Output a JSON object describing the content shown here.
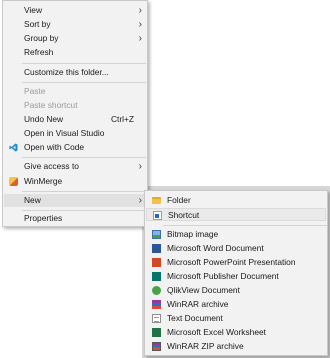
{
  "context_menu": {
    "items": [
      {
        "label": "View",
        "submenu": true
      },
      {
        "label": "Sort by",
        "submenu": true
      },
      {
        "label": "Group by",
        "submenu": true
      },
      {
        "label": "Refresh"
      },
      {
        "label": "Customize this folder..."
      },
      {
        "label": "Paste",
        "disabled": true
      },
      {
        "label": "Paste shortcut",
        "disabled": true
      },
      {
        "label": "Undo New",
        "shortcut": "Ctrl+Z"
      },
      {
        "label": "Open in Visual Studio"
      },
      {
        "label": "Open with Code",
        "icon": "vscode-icon"
      },
      {
        "label": "Give access to",
        "submenu": true
      },
      {
        "label": "WinMerge",
        "icon": "winmerge-icon"
      },
      {
        "label": "New",
        "submenu": true,
        "highlighted": true
      },
      {
        "label": "Properties"
      }
    ],
    "chevron_glyph": "›"
  },
  "new_submenu": {
    "items": [
      {
        "label": "Folder",
        "icon": "folder-icon"
      },
      {
        "label": "Shortcut",
        "icon": "shortcut-icon",
        "highlighted": true
      },
      {
        "label": "Bitmap image",
        "icon": "bitmap-icon"
      },
      {
        "label": "Microsoft Word Document",
        "icon": "word-icon"
      },
      {
        "label": "Microsoft PowerPoint Presentation",
        "icon": "ppt-icon"
      },
      {
        "label": "Microsoft Publisher Document",
        "icon": "publisher-icon"
      },
      {
        "label": "QlikView Document",
        "icon": "qlik-icon"
      },
      {
        "label": "WinRAR archive",
        "icon": "rar-icon"
      },
      {
        "label": "Text Document",
        "icon": "text-icon"
      },
      {
        "label": "Microsoft Excel Worksheet",
        "icon": "excel-icon"
      },
      {
        "label": "WinRAR ZIP archive",
        "icon": "rarzip-icon"
      }
    ]
  },
  "colors": {
    "menu_background": "#f2f2f2",
    "highlight": "#e1e1e1",
    "disabled_text": "#9a9a9a",
    "vscode_blue": "#1f8ad2"
  }
}
